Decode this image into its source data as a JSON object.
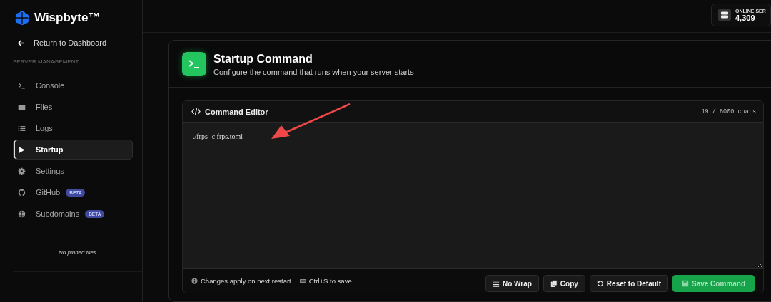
{
  "brand": {
    "name": "Wispbyte™"
  },
  "sidebar": {
    "back_link": "Return to Dashboard",
    "section": "SERVER MANAGEMENT",
    "items": [
      {
        "kind": "console",
        "label": "Console",
        "selected": false
      },
      {
        "kind": "files",
        "label": "Files",
        "selected": false
      },
      {
        "kind": "logs",
        "label": "Logs",
        "selected": false
      },
      {
        "kind": "startup",
        "label": "Startup",
        "selected": true
      },
      {
        "kind": "settings",
        "label": "Settings",
        "selected": false
      },
      {
        "kind": "github",
        "label": "GitHub",
        "selected": false,
        "badge": "BETA"
      },
      {
        "kind": "subdomains",
        "label": "Subdomains",
        "selected": false,
        "badge": "BETA"
      }
    ],
    "pinned_empty": "No pinned files"
  },
  "online_servers": {
    "label": "ONLINE SER",
    "value": "4,309"
  },
  "card": {
    "title": "Startup Command",
    "subtitle": "Configure the command that runs when your server starts",
    "editor": {
      "title": "Command Editor",
      "counter": "19 / 8000 chars",
      "value": "./frps -c frps.toml",
      "hints": [
        {
          "kind": "info",
          "text": "Changes apply on next restart"
        },
        {
          "kind": "keyboard",
          "text": "Ctrl+S to save"
        }
      ],
      "buttons": [
        {
          "kind": "wrap",
          "label": "No Wrap"
        },
        {
          "kind": "copy",
          "label": "Copy"
        },
        {
          "kind": "reset",
          "label": "Reset to Default"
        },
        {
          "kind": "save",
          "label": "Save Command"
        }
      ]
    }
  }
}
